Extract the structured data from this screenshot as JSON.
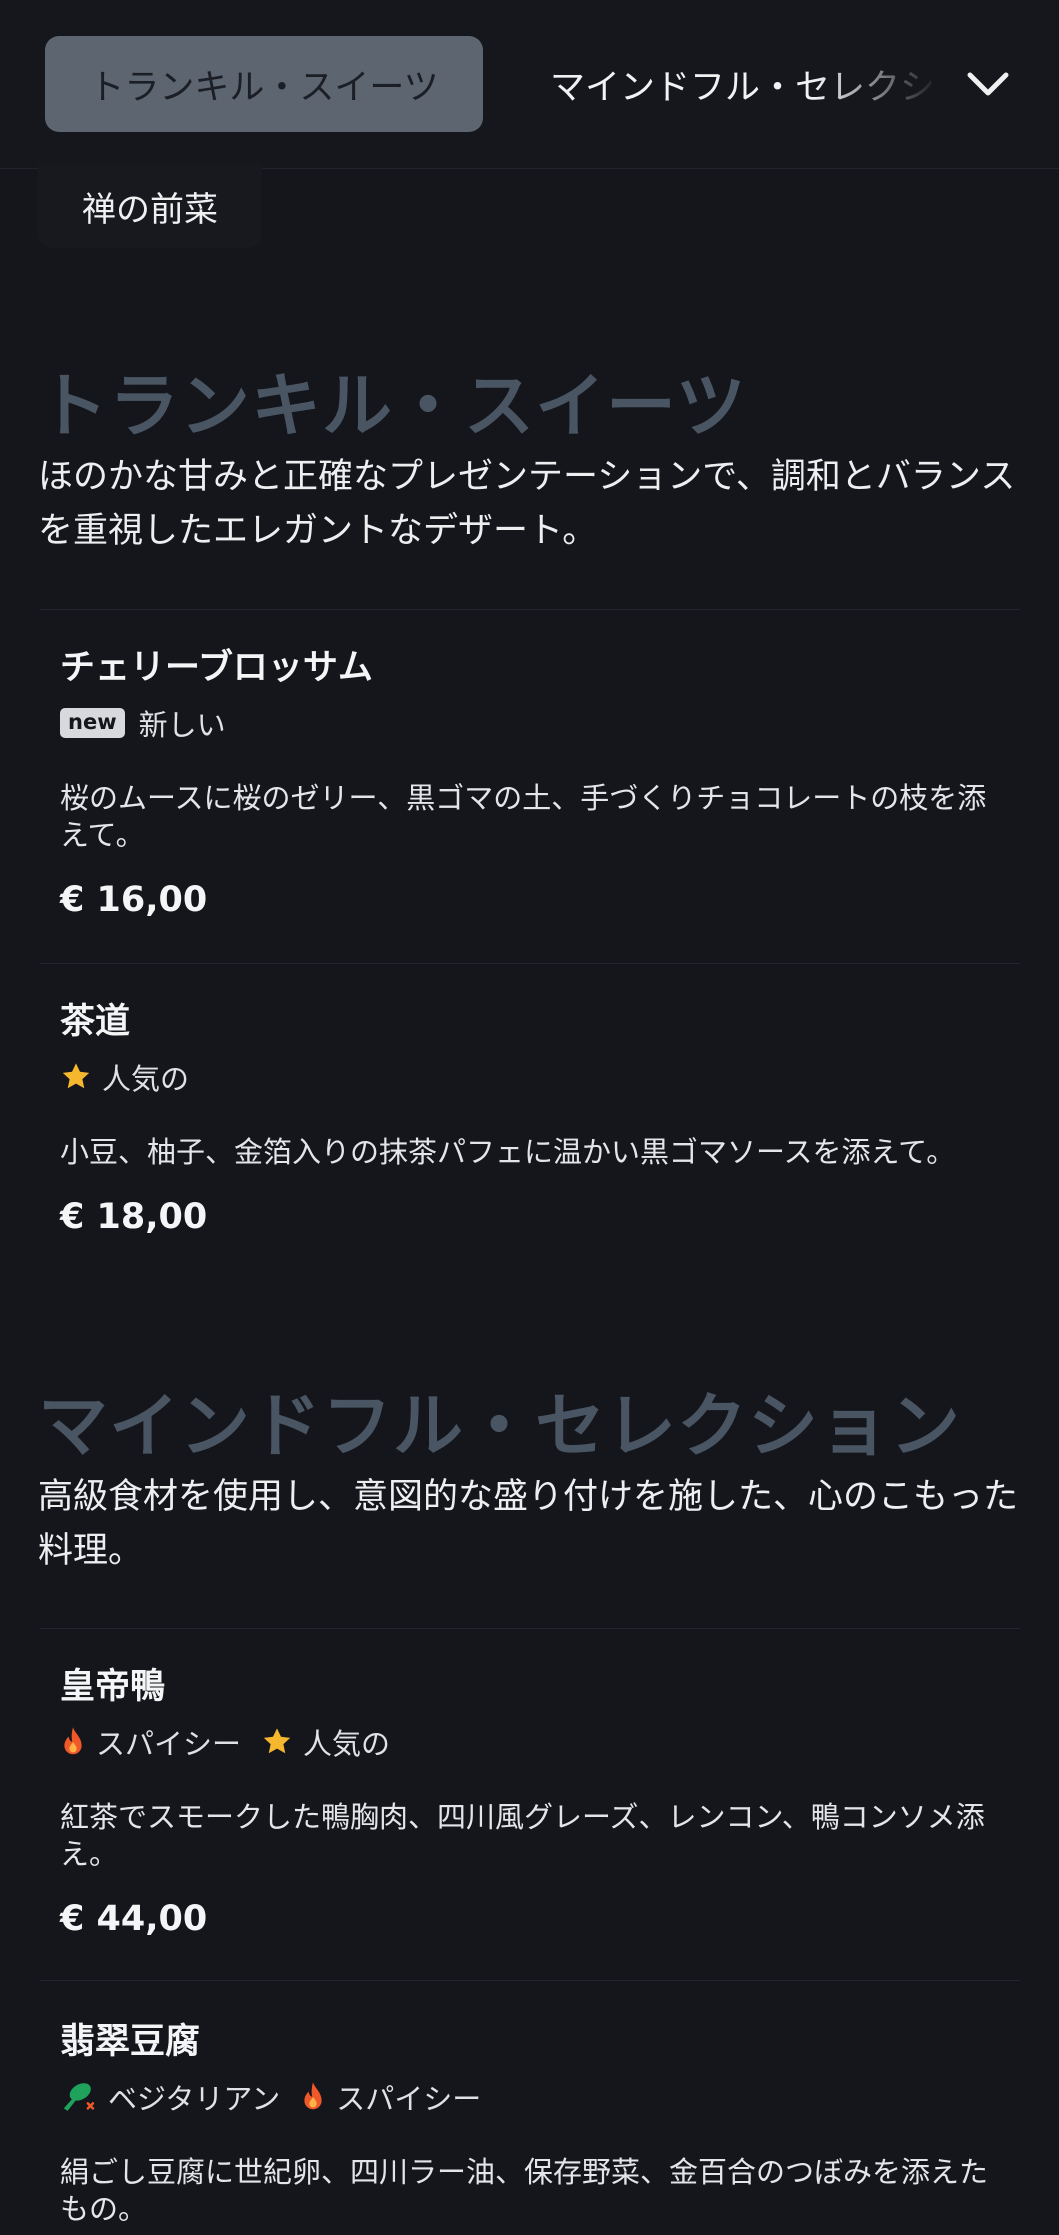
{
  "nav": {
    "active_tab": "トランキル・スイーツ",
    "next_tab": "マインドフル・セレクション",
    "chevron_icon": "chevron-down-icon",
    "sub_tab": "禅の前菜"
  },
  "sections": [
    {
      "title": "トランキル・スイーツ",
      "description": "ほのかな甘みと正確なプレゼンテーションで、調和とバランスを重視したエレガントなデザート。",
      "items": [
        {
          "name": "チェリーブロッサム",
          "tags": [
            {
              "icon": "new-badge",
              "badge": "new",
              "label": "新しい"
            }
          ],
          "description": "桜のムースに桜のゼリー、黒ゴマの土、手づくりチョコレートの枝を添えて。",
          "price": "€ 16,00"
        },
        {
          "name": "茶道",
          "tags": [
            {
              "icon": "star-icon",
              "label": "人気の"
            }
          ],
          "description": "小豆、柚子、金箔入りの抹茶パフェに温かい黒ゴマソースを添えて。",
          "price": "€ 18,00"
        }
      ]
    },
    {
      "title": "マインドフル・セレクション",
      "description": "高級食材を使用し、意図的な盛り付けを施した、心のこもった料理。",
      "items": [
        {
          "name": "皇帝鴨",
          "tags": [
            {
              "icon": "flame-icon",
              "label": "スパイシー"
            },
            {
              "icon": "star-icon",
              "label": "人気の"
            }
          ],
          "description": "紅茶でスモークした鴨胸肉、四川風グレーズ、レンコン、鴨コンソメ添え。",
          "price": "€ 44,00"
        },
        {
          "name": "翡翠豆腐",
          "tags": [
            {
              "icon": "vegetarian-icon",
              "label": "ベジタリアン"
            },
            {
              "icon": "flame-icon",
              "label": "スパイシー"
            }
          ],
          "description": "絹ごし豆腐に世紀卵、四川ラー油、保存野菜、金百合のつぼみを添えたもの。"
        }
      ]
    }
  ],
  "colors": {
    "background": "#14161b",
    "active_tab": "#5c6570",
    "section_title": "#4a5564",
    "star": "#f5b72e",
    "flame": "#f0582a",
    "vegetarian": "#1fa25c"
  }
}
